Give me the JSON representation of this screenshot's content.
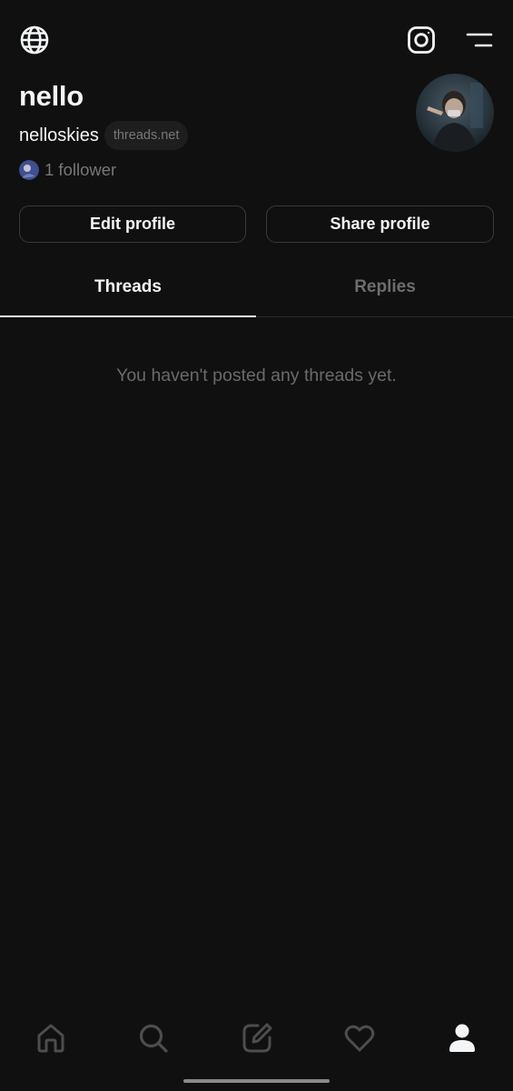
{
  "header": {
    "globe_icon": "globe-icon",
    "instagram_icon": "instagram-icon",
    "menu_icon": "menu-icon"
  },
  "profile": {
    "display_name": "nello",
    "handle": "nelloskies",
    "domain_badge": "threads.net",
    "follower_text": "1 follower"
  },
  "actions": {
    "edit_label": "Edit profile",
    "share_label": "Share profile"
  },
  "tabs": [
    {
      "label": "Threads",
      "active": true
    },
    {
      "label": "Replies",
      "active": false
    }
  ],
  "feed": {
    "empty_message": "You haven't posted any threads yet."
  },
  "bottom_nav": {
    "items": [
      {
        "icon": "home-icon",
        "active": false
      },
      {
        "icon": "search-icon",
        "active": false
      },
      {
        "icon": "compose-icon",
        "active": false
      },
      {
        "icon": "heart-icon",
        "active": false
      },
      {
        "icon": "profile-icon",
        "active": true
      }
    ]
  },
  "colors": {
    "background": "#101010",
    "text_primary": "#f3f5f7",
    "text_secondary": "#777777",
    "icon_inactive": "#4d4d4d"
  }
}
